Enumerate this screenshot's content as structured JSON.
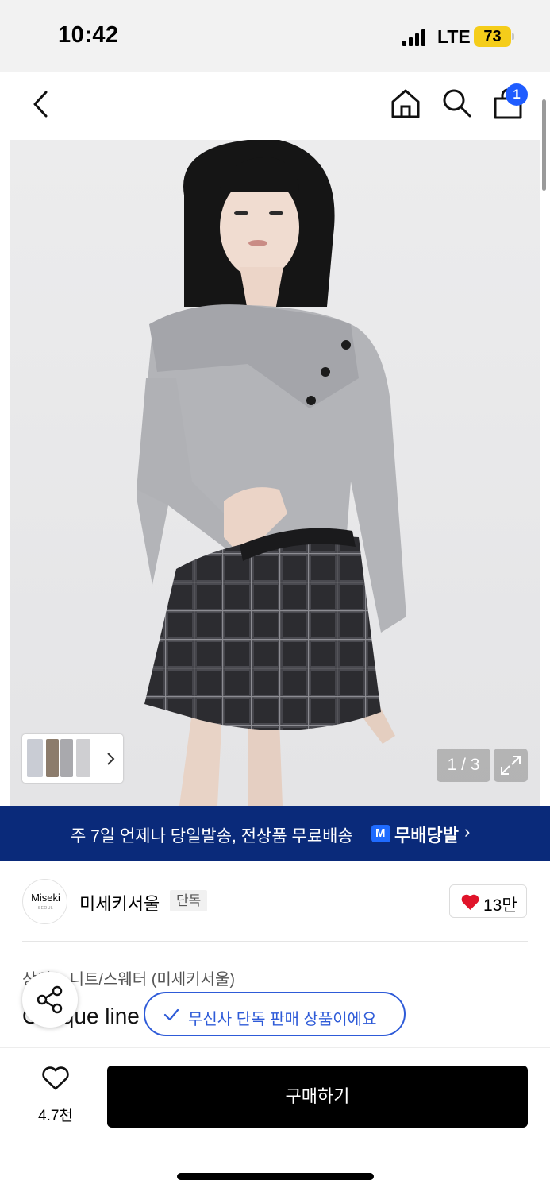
{
  "status_bar": {
    "time": "10:42",
    "network": "LTE",
    "battery": "73"
  },
  "nav": {
    "cart_count": "1"
  },
  "gallery": {
    "pager": "1 / 3"
  },
  "promo": {
    "text": "주 7일 언제나 당일발송, 전상품 무료배송",
    "brand": "무배당발",
    "logo_letter": "M",
    "arrow": "›"
  },
  "brand": {
    "logo_text": "Miseki",
    "logo_sub": "SEOUL",
    "name": "미세키서울",
    "tag": "단독",
    "likes": "13만"
  },
  "product": {
    "category": "상의 > 니트/스웨터 (미세키서울)",
    "name": "Oblique line cardigan knit_GREY"
  },
  "toast": {
    "text": "무신사 단독 판매 상품이에요"
  },
  "bottom": {
    "wish_count": "4.7천",
    "buy_label": "구매하기"
  },
  "colors": {
    "accent_blue": "#2e5bd8",
    "promo_bg": "#0a2a7a",
    "badge_blue": "#1f5cff",
    "heart_red": "#e0142a",
    "battery_yellow": "#f5cd1a"
  }
}
